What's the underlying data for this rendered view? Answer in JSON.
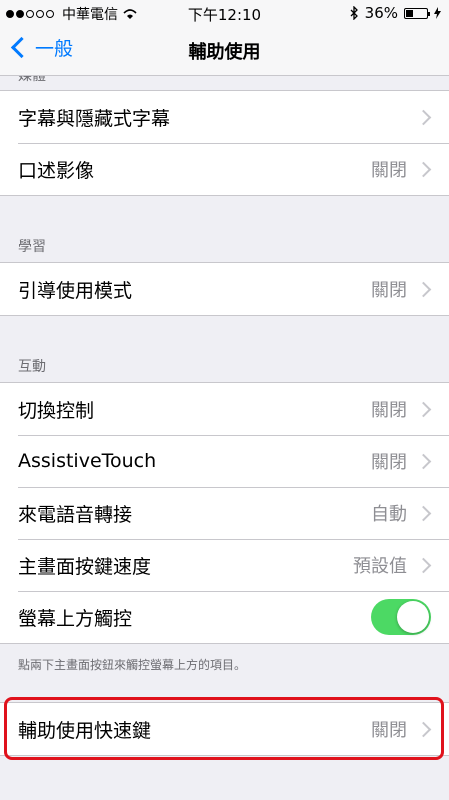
{
  "status_bar": {
    "carrier": "中華電信",
    "time": "下午12:10",
    "battery": "36%",
    "battery_level": 0.36
  },
  "nav": {
    "back_label": "一般",
    "title": "輔助使用"
  },
  "groups": {
    "media": {
      "header": "媒體",
      "items": [
        {
          "label": "字幕與隱藏式字幕",
          "value": ""
        },
        {
          "label": "口述影像",
          "value": "關閉"
        }
      ]
    },
    "learning": {
      "header": "學習",
      "items": [
        {
          "label": "引導使用模式",
          "value": "關閉"
        }
      ]
    },
    "interaction": {
      "header": "互動",
      "items": [
        {
          "label": "切換控制",
          "value": "關閉"
        },
        {
          "label": "AssistiveTouch",
          "value": "關閉"
        },
        {
          "label": "來電語音轉接",
          "value": "自動"
        },
        {
          "label": "主畫面按鍵速度",
          "value": "預設值"
        },
        {
          "label": "螢幕上方觸控",
          "toggle": true
        }
      ],
      "footer": "點兩下主畫面按鈕來觸控螢幕上方的項目。"
    },
    "shortcut": {
      "items": [
        {
          "label": "輔助使用快速鍵",
          "value": "關閉"
        }
      ]
    }
  },
  "colors": {
    "accent": "#007aff",
    "toggle_on": "#4cd964",
    "highlight": "#e0121c"
  }
}
